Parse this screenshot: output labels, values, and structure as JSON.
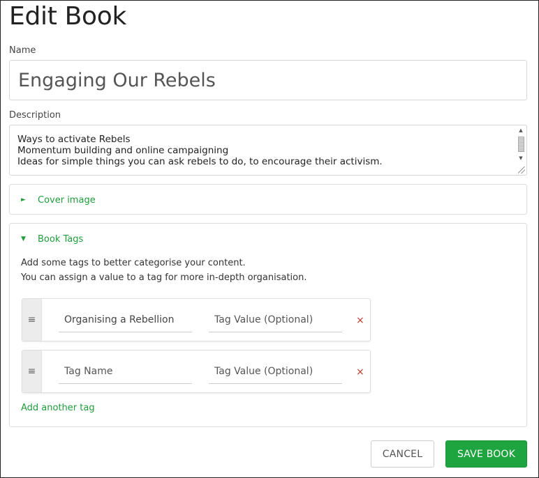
{
  "page": {
    "title": "Edit Book"
  },
  "name_field": {
    "label": "Name",
    "value": "Engaging Our Rebels"
  },
  "description_field": {
    "label": "Description",
    "value": "Ways to activate Rebels\nMomentum building and online campaigning\nIdeas for simple things you can ask rebels to do, to encourage their activism."
  },
  "cover_section": {
    "label": "Cover image",
    "expanded": false
  },
  "tags_section": {
    "label": "Book Tags",
    "expanded": true,
    "help_line_1": "Add some tags to better categorise your content.",
    "help_line_2": "You can assign a value to a tag for more in-depth organisation.",
    "tags": [
      {
        "name": "Organising a Rebellion",
        "name_placeholder": "Tag Name",
        "value": "",
        "value_placeholder": "Tag Value (Optional)"
      },
      {
        "name": "",
        "name_placeholder": "Tag Name",
        "value": "",
        "value_placeholder": "Tag Value (Optional)"
      }
    ],
    "add_tag_label": "Add another tag"
  },
  "actions": {
    "cancel_label": "CANCEL",
    "save_label": "SAVE BOOK"
  },
  "icons": {
    "drag": "≡",
    "remove": "×",
    "collapsed": "►",
    "expanded": "▼"
  },
  "colors": {
    "accent": "#1ea53f",
    "remove": "#c0392b"
  }
}
